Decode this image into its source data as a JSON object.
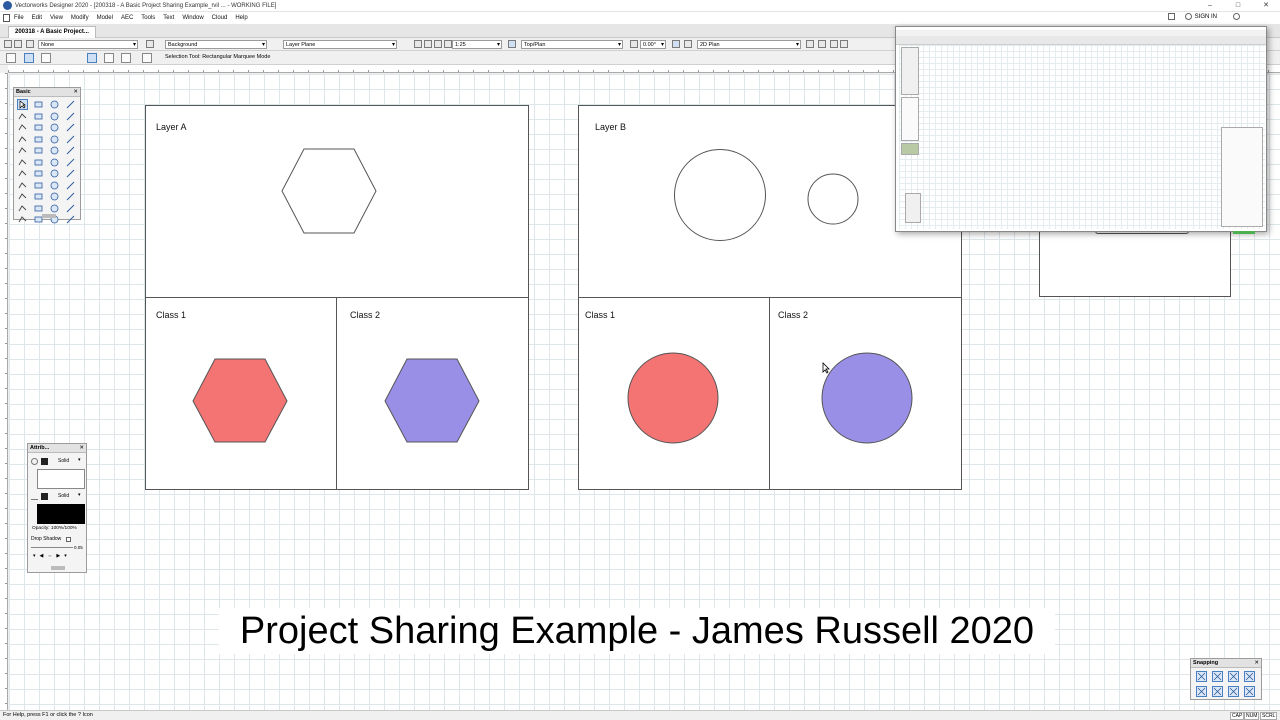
{
  "window": {
    "title": "Vectorworks Designer 2020 - [200318 - A Basic Project Sharing Example_rvil ... - WORKING FILE]",
    "min": "–",
    "max": "□",
    "close": "✕"
  },
  "menu": {
    "items": [
      "File",
      "Edit",
      "View",
      "Modify",
      "Model",
      "AEC",
      "Tools",
      "Text",
      "Window",
      "Cloud",
      "Help"
    ],
    "sign_in": "SIGN IN"
  },
  "tab": {
    "label": "200318 - A Basic Project..."
  },
  "view_bar": {
    "class": "None",
    "layer": "Background",
    "plane": "Layer Plane",
    "scale": "1:25",
    "view": "Top/Plan",
    "angle": "0.00°",
    "render": "2D Plan"
  },
  "mode_bar": {
    "text": "Selection Tool: Rectangular Marquee Mode"
  },
  "basic_palette": {
    "title": "Basic",
    "close": "✕"
  },
  "attributes": {
    "title": "Attrib...",
    "fill_style": "Solid",
    "pen_style": "Solid",
    "opacity": "Opacity: 100%/100%",
    "drop_shadow": "Drop Shadow",
    "line_weight": "0.05"
  },
  "frames": {
    "layer_a": "Layer A",
    "layer_b": "Layer B",
    "a_class1": "Class 1",
    "a_class2": "Class 2",
    "b_class1": "Class 1",
    "b_class2": "Class 2"
  },
  "colors": {
    "class1_fill": "#f47373",
    "class2_fill": "#9a8fe6",
    "grid": "#dfe6ea"
  },
  "caption": "Project Sharing Example - James Russell 2020",
  "snapping": {
    "title": "Snapping",
    "close": "✕"
  },
  "status_bar": {
    "help": "For Help, press F1 or click the ? Icon",
    "cap": "CAP",
    "num": "NUM",
    "scrl": "SCRL"
  }
}
